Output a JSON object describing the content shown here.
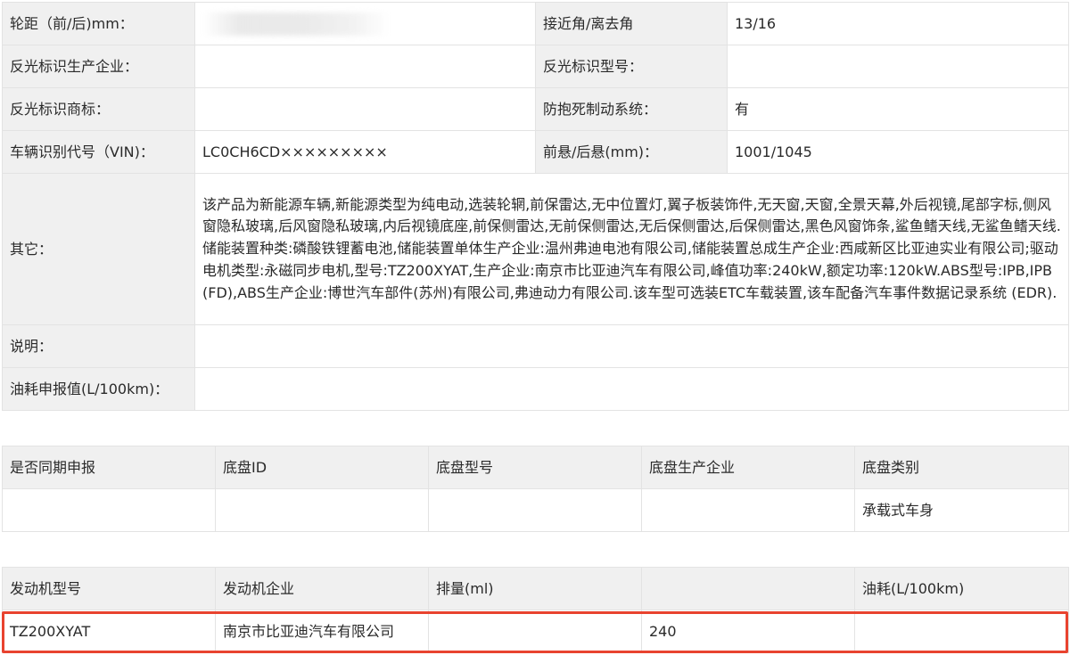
{
  "spec": {
    "wheelbase_label": "轮距（前/后)mm：",
    "wheelbase_value": "",
    "approach_label": "接近角/离去角",
    "approach_value": "13/16",
    "reflector_maker_label": "反光标识生产企业：",
    "reflector_maker_value": "",
    "reflector_model_label": "反光标识型号：",
    "reflector_model_value": "",
    "reflector_brand_label": "反光标识商标：",
    "reflector_brand_value": "",
    "abs_label": "防抱死制动系统：",
    "abs_value": "有",
    "vin_label": "车辆识别代号（VIN)：",
    "vin_value": "LC0CH6CD×××××××××",
    "overhang_label": "前悬/后悬(mm)：",
    "overhang_value": "1001/1045",
    "other_label": "其它：",
    "other_value": "该产品为新能源车辆,新能源类型为纯电动,选装轮辋,前保雷达,无中位置灯,翼子板装饰件,无天窗,天窗,全景天幕,外后视镜,尾部字标,侧风窗隐私玻璃,后风窗隐私玻璃,内后视镜底座,前保侧雷达,无前保侧雷达,无后保侧雷达,后保侧雷达,黑色风窗饰条,鲨鱼鳍天线,无鲨鱼鳍天线.储能装置种类:磷酸铁锂蓄电池,储能装置单体生产企业:温州弗迪电池有限公司,储能装置总成生产企业:西咸新区比亚迪实业有限公司;驱动电机类型:永磁同步电机,型号:TZ200XYAT,生产企业:南京市比亚迪汽车有限公司,峰值功率:240kW,额定功率:120kW.ABS型号:IPB,IPB(FD),ABS生产企业:博世汽车部件(苏州)有限公司,弗迪动力有限公司.该车型可选装ETC车载装置,该车配备汽车事件数据记录系统 (EDR).",
    "note_label": "说明：",
    "note_value": "",
    "fuel_label": "油耗申报值(L/100km)：",
    "fuel_value": ""
  },
  "chassis": {
    "headers": [
      "是否同期申报",
      "底盘ID",
      "底盘型号",
      "底盘生产企业",
      "底盘类别"
    ],
    "row": [
      "",
      "",
      "",
      "",
      "承载式车身"
    ]
  },
  "engine": {
    "headers": [
      "发动机型号",
      "发动机企业",
      "排量(ml)",
      "",
      "油耗(L/100km)"
    ],
    "row": [
      "TZ200XYAT",
      "南京市比亚迪汽车有限公司",
      "",
      "240",
      ""
    ]
  },
  "colors": {
    "label_bg": "#f0f0f0",
    "border": "#e3e3e3",
    "highlight": "#e8432f"
  }
}
